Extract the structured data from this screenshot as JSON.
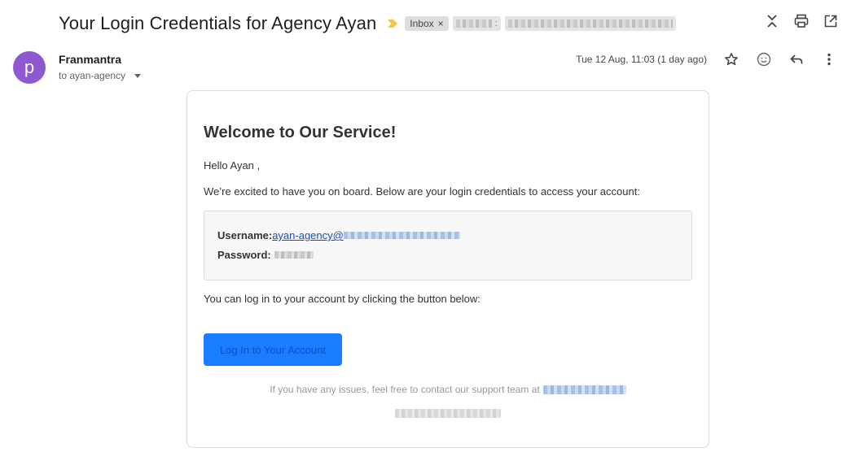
{
  "subject": "Your Login Credentials for Agency Ayan",
  "labels": {
    "inbox": "Inbox",
    "remove": "×",
    "separator": ":"
  },
  "sender": {
    "avatar_letter": "p",
    "avatar_color": "#8e59d0",
    "name": "Franmantra",
    "to": "to ayan-agency",
    "date": "Tue 12 Aug, 11:03 (1 day ago)"
  },
  "icons": {
    "importance": "label-important-icon",
    "collapse": "collapse-all-icon",
    "print": "print-icon",
    "open": "open-in-new-window-icon",
    "star": "star-icon",
    "emoji": "emoji-reaction-icon",
    "reply": "reply-icon",
    "more": "more-vert-icon"
  },
  "email": {
    "heading": "Welcome to Our Service!",
    "greeting": "Hello Ayan ,",
    "intro": "We’re excited to have you on board. Below are your login credentials to access your account:",
    "username_label": "Username:",
    "username_value": "ayan-agency@",
    "password_label": "Password:",
    "login_prompt": "You can log in to your account by clicking the button below:",
    "button_label": "Log In to Your Account",
    "support_text": "If you have any issues, feel free to contact our support team at"
  },
  "colors": {
    "button": "#1a7cff",
    "link": "#1a4ebd",
    "importance": "#f2c94c"
  }
}
